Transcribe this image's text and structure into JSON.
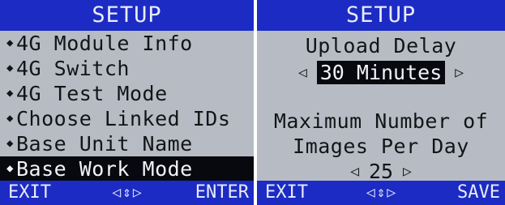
{
  "left_screen": {
    "title": "SETUP",
    "menu_items": [
      {
        "label": "4G Module Info"
      },
      {
        "label": "4G Switch"
      },
      {
        "label": "4G Test Mode"
      },
      {
        "label": "Choose Linked IDs"
      },
      {
        "label": "Base Unit Name"
      },
      {
        "label": "Base Work Mode",
        "selected": true
      }
    ],
    "bottom": {
      "left_softkey": "EXIT",
      "right_softkey": "ENTER"
    }
  },
  "right_screen": {
    "title": "SETUP",
    "upload_delay": {
      "label": "Upload Delay",
      "value": "30 Minutes"
    },
    "max_images": {
      "label_line1": "Maximum Number of",
      "label_line2": "Images Per Day",
      "value": "25"
    },
    "bottom": {
      "left_softkey": "EXIT",
      "right_softkey": "SAVE"
    }
  },
  "icons": {
    "bullet": "diamond-bullet-icon",
    "nav": [
      "arrow-left-icon",
      "arrow-up-down-icon",
      "arrow-right-icon"
    ]
  },
  "colors": {
    "title_bar": "#1c2bc4",
    "screen_bg": "#b7bcc4",
    "highlight_bg": "#07090f",
    "highlight_text": "#f1f3f8"
  }
}
